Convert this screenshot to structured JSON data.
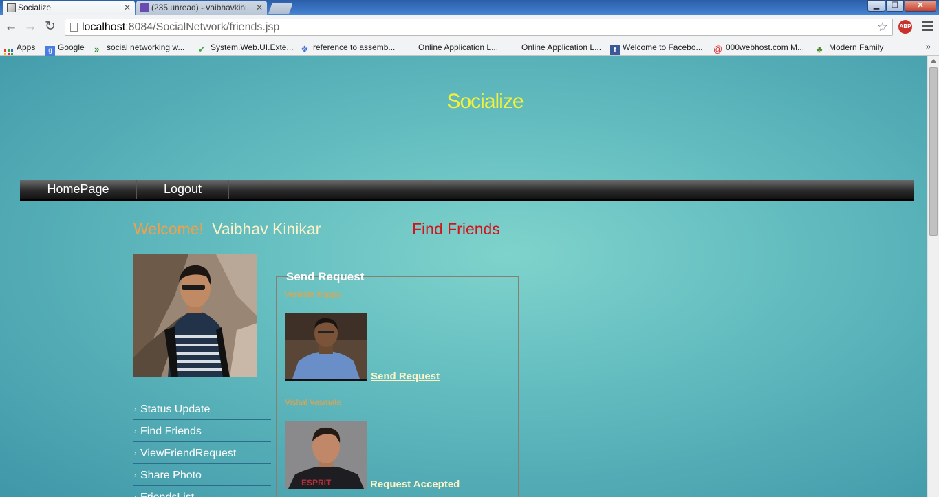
{
  "browser": {
    "tabs": [
      {
        "label": "Socialize",
        "active": true
      },
      {
        "label": "(235 unread) - vaibhavkini",
        "active": false
      }
    ],
    "url_host": "localhost",
    "url_path": ":8084/SocialNetwork/friends.jsp",
    "abp_label": "ABP",
    "bookmarks": [
      {
        "label": "Apps",
        "icon": "apps-grid-icon"
      },
      {
        "label": "Google",
        "icon": "google-icon"
      },
      {
        "label": "social networking w...",
        "icon": "chevrons-icon"
      },
      {
        "label": "System.Web.UI.Exte...",
        "icon": "checkmark-icon"
      },
      {
        "label": "reference to assemb...",
        "icon": "dropbox-icon"
      },
      {
        "label": "Online Application L...",
        "icon": ""
      },
      {
        "label": "Online Application L...",
        "icon": ""
      },
      {
        "label": "Welcome to Facebo...",
        "icon": "facebook-icon"
      },
      {
        "label": "000webhost.com M...",
        "icon": "swirl-icon"
      },
      {
        "label": "Modern Family",
        "icon": "tree-icon"
      }
    ],
    "more_label": "»"
  },
  "site": {
    "title": "Socialize",
    "nav": [
      "HomePage",
      "Logout"
    ],
    "welcome_label": "Welcome!",
    "user_name": "Vaibhav Kinikar",
    "page_heading": "Find Friends",
    "side_menu": [
      "Status Update",
      "Find Friends",
      "ViewFriendRequest",
      "Share Photo",
      "FriendsList"
    ],
    "send_request": {
      "legend": "Send Request",
      "people": [
        {
          "name": "Venkata Koppu",
          "action": "Send Request",
          "is_link": true
        },
        {
          "name": "Vishal Vasmate",
          "action": "Request Accepted",
          "is_link": false
        }
      ]
    }
  },
  "colors": {
    "title": "#f4f13a",
    "welcome_label": "#f0a04a",
    "heading": "#d4141a",
    "person_name": "#e8a24a"
  }
}
